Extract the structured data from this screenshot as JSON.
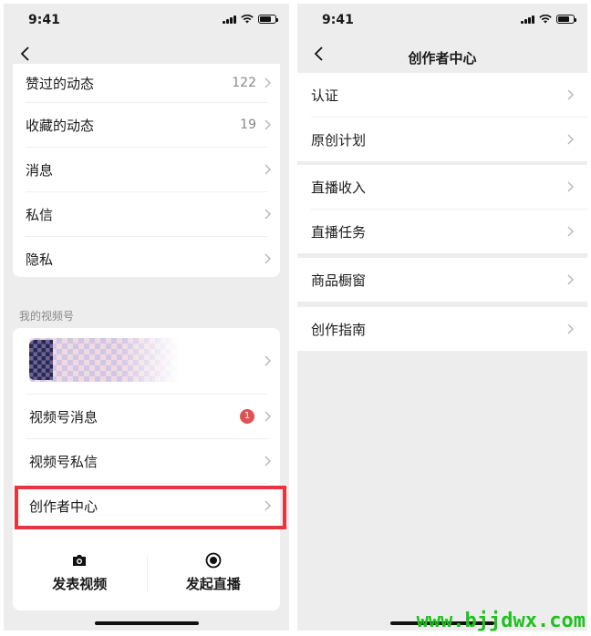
{
  "left": {
    "status_time": "9:41",
    "list": [
      {
        "label": "赞过的动态",
        "value": "122"
      },
      {
        "label": "收藏的动态",
        "value": "19"
      },
      {
        "label": "消息",
        "value": ""
      },
      {
        "label": "私信",
        "value": ""
      },
      {
        "label": "隐私",
        "value": ""
      }
    ],
    "section_title": "我的视频号",
    "channel_items": [
      {
        "label": "视频号消息",
        "badge": "1"
      },
      {
        "label": "视频号私信"
      },
      {
        "label": "创作者中心"
      }
    ],
    "actions": [
      {
        "label": "发表视频",
        "icon": "camera-icon"
      },
      {
        "label": "发起直播",
        "icon": "live-record-icon"
      }
    ]
  },
  "right": {
    "status_time": "9:41",
    "title": "创作者中心",
    "groups": [
      [
        "认证",
        "原创计划"
      ],
      [
        "直播收入",
        "直播任务"
      ],
      [
        "商品橱窗"
      ],
      [
        "创作指南"
      ]
    ]
  },
  "watermark": "www.bjjdwx.com",
  "colors": {
    "highlight": "#e8353b",
    "badge": "#e05252",
    "watermark": "#1dc21d",
    "background": "#ededed"
  }
}
